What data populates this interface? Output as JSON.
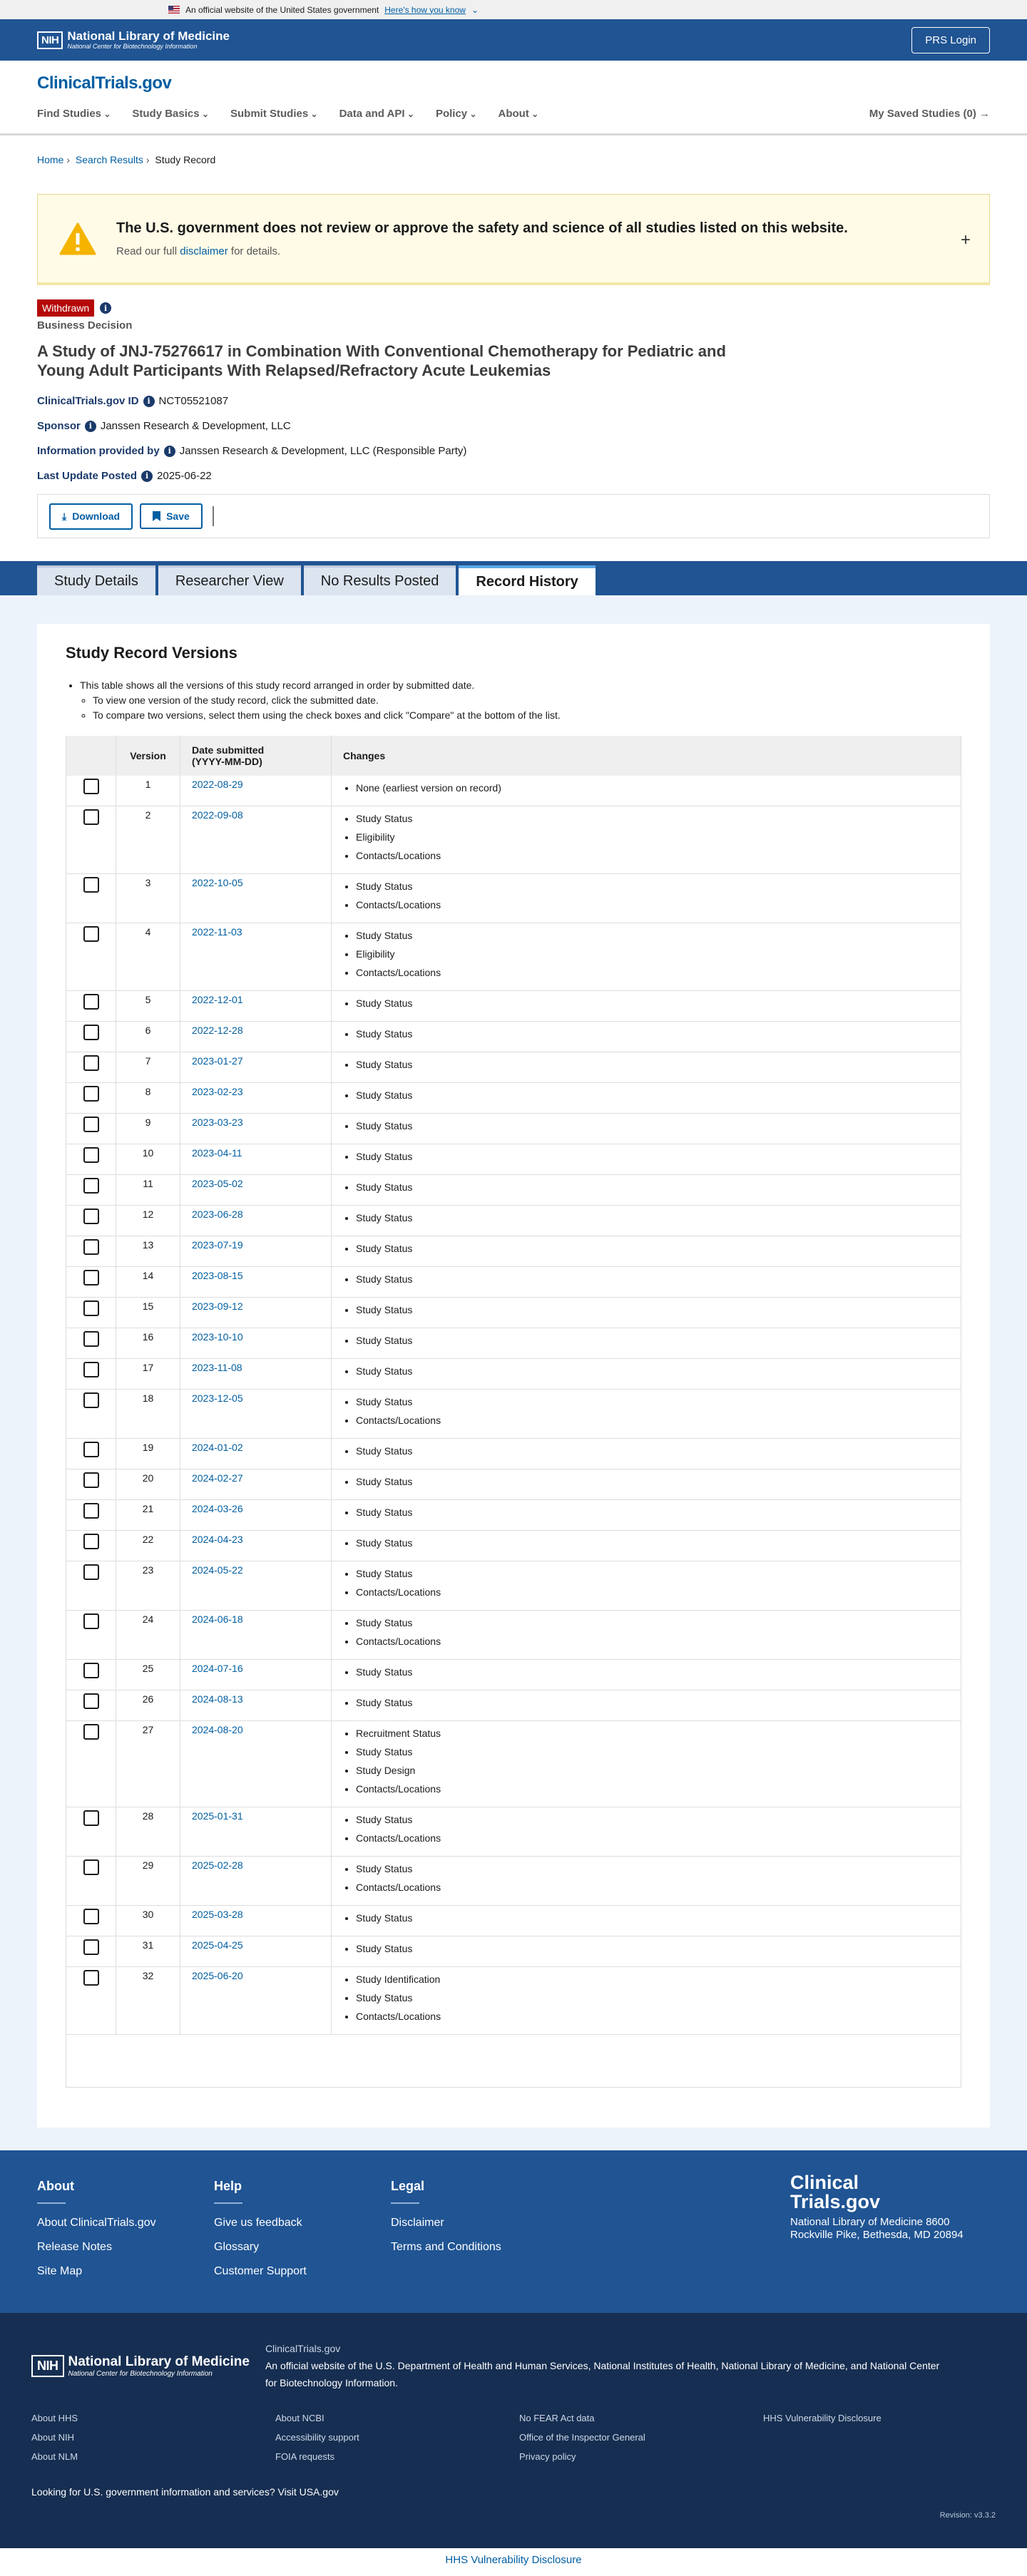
{
  "gov_banner": {
    "text": "An official website of the United States government",
    "how": "Here's how you know"
  },
  "nih": {
    "box": "NIH",
    "title": "National Library of Medicine",
    "subtitle": "National Center for Biotechnology Information",
    "prs_login": "PRS Login"
  },
  "site": {
    "logo": "ClinicalTrials.gov"
  },
  "nav": {
    "items": [
      "Find Studies",
      "Study Basics",
      "Submit Studies",
      "Data and API",
      "Policy",
      "About"
    ],
    "saved": "My Saved Studies (0)"
  },
  "breadcrumb": {
    "home": "Home",
    "search": "Search Results",
    "current": "Study Record"
  },
  "notice": {
    "title": "The U.S. government does not review or approve the safety and science of all studies listed on this website.",
    "sub_before": "Read our full",
    "sub_link": "disclaimer",
    "sub_after": "for details.",
    "expand": "+"
  },
  "study": {
    "status": "Withdrawn",
    "status_reason": "Business Decision",
    "title": "A Study of JNJ-75276617 in Combination With Conventional Chemotherapy for Pediatric and Young Adult Participants With Relapsed/Refractory Acute Leukemias",
    "id_label": "ClinicalTrials.gov ID",
    "id": "NCT05521087",
    "sponsor_label": "Sponsor",
    "sponsor": "Janssen Research & Development, LLC",
    "provided_label": "Information provided by",
    "provided": "Janssen Research & Development, LLC (Responsible Party)",
    "updated_label": "Last Update Posted",
    "updated": "2025-06-22"
  },
  "actions": {
    "download": "Download",
    "save": "Save"
  },
  "tabs": [
    "Study Details",
    "Researcher View",
    "No Results Posted",
    "Record History"
  ],
  "history": {
    "title": "Study Record Versions",
    "note1": "This table shows all the versions of this study record arranged in order by submitted date.",
    "note2": "To view one version of the study record, click the submitted date.",
    "note3": "To compare two versions, select them using the check boxes and click \"Compare\" at the bottom of the list.",
    "col_version": "Version",
    "col_date": "Date submitted (YYYY-MM-DD)",
    "col_changes": "Changes",
    "rows": [
      {
        "v": "1",
        "d": "2022-08-29",
        "c": [
          "None (earliest version on record)"
        ]
      },
      {
        "v": "2",
        "d": "2022-09-08",
        "c": [
          "Study Status",
          "Eligibility",
          "Contacts/Locations"
        ]
      },
      {
        "v": "3",
        "d": "2022-10-05",
        "c": [
          "Study Status",
          "Contacts/Locations"
        ]
      },
      {
        "v": "4",
        "d": "2022-11-03",
        "c": [
          "Study Status",
          "Eligibility",
          "Contacts/Locations"
        ]
      },
      {
        "v": "5",
        "d": "2022-12-01",
        "c": [
          "Study Status"
        ]
      },
      {
        "v": "6",
        "d": "2022-12-28",
        "c": [
          "Study Status"
        ]
      },
      {
        "v": "7",
        "d": "2023-01-27",
        "c": [
          "Study Status"
        ]
      },
      {
        "v": "8",
        "d": "2023-02-23",
        "c": [
          "Study Status"
        ]
      },
      {
        "v": "9",
        "d": "2023-03-23",
        "c": [
          "Study Status"
        ]
      },
      {
        "v": "10",
        "d": "2023-04-11",
        "c": [
          "Study Status"
        ]
      },
      {
        "v": "11",
        "d": "2023-05-02",
        "c": [
          "Study Status"
        ]
      },
      {
        "v": "12",
        "d": "2023-06-28",
        "c": [
          "Study Status"
        ]
      },
      {
        "v": "13",
        "d": "2023-07-19",
        "c": [
          "Study Status"
        ]
      },
      {
        "v": "14",
        "d": "2023-08-15",
        "c": [
          "Study Status"
        ]
      },
      {
        "v": "15",
        "d": "2023-09-12",
        "c": [
          "Study Status"
        ]
      },
      {
        "v": "16",
        "d": "2023-10-10",
        "c": [
          "Study Status"
        ]
      },
      {
        "v": "17",
        "d": "2023-11-08",
        "c": [
          "Study Status"
        ]
      },
      {
        "v": "18",
        "d": "2023-12-05",
        "c": [
          "Study Status",
          "Contacts/Locations"
        ]
      },
      {
        "v": "19",
        "d": "2024-01-02",
        "c": [
          "Study Status"
        ]
      },
      {
        "v": "20",
        "d": "2024-02-27",
        "c": [
          "Study Status"
        ]
      },
      {
        "v": "21",
        "d": "2024-03-26",
        "c": [
          "Study Status"
        ]
      },
      {
        "v": "22",
        "d": "2024-04-23",
        "c": [
          "Study Status"
        ]
      },
      {
        "v": "23",
        "d": "2024-05-22",
        "c": [
          "Study Status",
          "Contacts/Locations"
        ]
      },
      {
        "v": "24",
        "d": "2024-06-18",
        "c": [
          "Study Status",
          "Contacts/Locations"
        ]
      },
      {
        "v": "25",
        "d": "2024-07-16",
        "c": [
          "Study Status"
        ]
      },
      {
        "v": "26",
        "d": "2024-08-13",
        "c": [
          "Study Status"
        ]
      },
      {
        "v": "27",
        "d": "2024-08-20",
        "c": [
          "Recruitment Status",
          "Study Status",
          "Study Design",
          "Contacts/Locations"
        ]
      },
      {
        "v": "28",
        "d": "2025-01-31",
        "c": [
          "Study Status",
          "Contacts/Locations"
        ]
      },
      {
        "v": "29",
        "d": "2025-02-28",
        "c": [
          "Study Status",
          "Contacts/Locations"
        ]
      },
      {
        "v": "30",
        "d": "2025-03-28",
        "c": [
          "Study Status"
        ]
      },
      {
        "v": "31",
        "d": "2025-04-25",
        "c": [
          "Study Status"
        ]
      },
      {
        "v": "32",
        "d": "2025-06-20",
        "c": [
          "Study Identification",
          "Study Status",
          "Contacts/Locations"
        ]
      }
    ]
  },
  "footer": {
    "about": {
      "title": "About",
      "links": [
        "About ClinicalTrials.gov",
        "Release Notes",
        "Site Map"
      ]
    },
    "help": {
      "title": "Help",
      "links": [
        "Give us feedback",
        "Glossary",
        "Customer Support"
      ]
    },
    "legal": {
      "title": "Legal",
      "links": [
        "Disclaimer",
        "Terms and Conditions"
      ]
    },
    "brand_line1": "Clinical",
    "brand_line2": "Trials.gov",
    "address": "National Library of Medicine 8600 Rockville Pike, Bethesda, MD 20894"
  },
  "bottom": {
    "site": "ClinicalTrials.gov",
    "official_lead": "An official website of the",
    "hhs": "U.S. Department of Health and Human Services",
    "nih": "National Institutes of Health",
    "nlm": "National Library of Medicine",
    "and": "and",
    "ncbi": "National Center for Biotechnology Information",
    "links": [
      "About HHS",
      "About NCBI",
      "No FEAR Act data",
      "HHS Vulnerability Disclosure",
      "About NIH",
      "Accessibility support",
      "Office of the Inspector General",
      "",
      "About NLM",
      "FOIA requests",
      "Privacy policy",
      ""
    ],
    "gov_text": "Looking for U.S. government information and services?",
    "gov_link": "Visit USA.gov",
    "revision": "Revision: v3.3.2",
    "last_link": "HHS Vulnerability Disclosure"
  }
}
